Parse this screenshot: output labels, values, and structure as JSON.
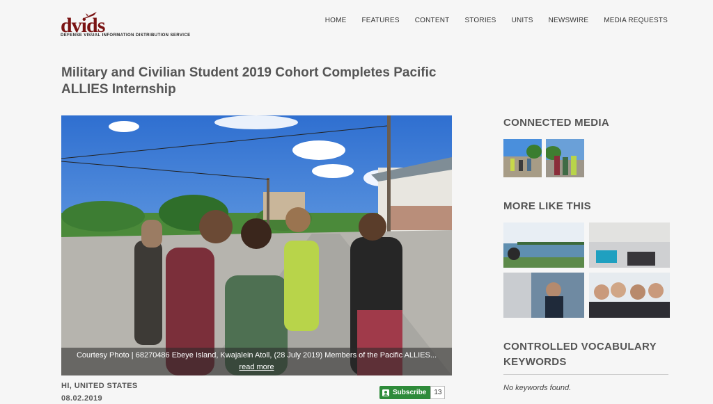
{
  "header": {
    "logo_text": "dvids",
    "logo_subtitle": "Defense Visual Information Distribution Service",
    "nav": [
      "HOME",
      "FEATURES",
      "CONTENT",
      "STORIES",
      "UNITS",
      "NEWSWIRE",
      "MEDIA REQUESTS"
    ]
  },
  "article": {
    "title": "Military and Civilian Student 2019 Cohort Completes Pacific ALLIES Internship",
    "caption": "Courtesy Photo | 68270486 Ebeye Island, Kwajalein Atoll, (28 July 2019) Members of the Pacific ALLIES...",
    "caption_link": "read more",
    "location": "HI, UNITED STATES",
    "date": "08.02.2019",
    "subscribe_label": "Subscribe",
    "subscribe_count": "13"
  },
  "sidebar": {
    "connected_media_heading": "CONNECTED MEDIA",
    "more_like_this_heading": "MORE LIKE THIS",
    "keywords_heading": "CONTROLLED VOCABULARY KEYWORDS",
    "no_keywords": "No keywords found."
  },
  "colors": {
    "brand": "#7a1313",
    "subscribe_green": "#2e8b3a"
  }
}
